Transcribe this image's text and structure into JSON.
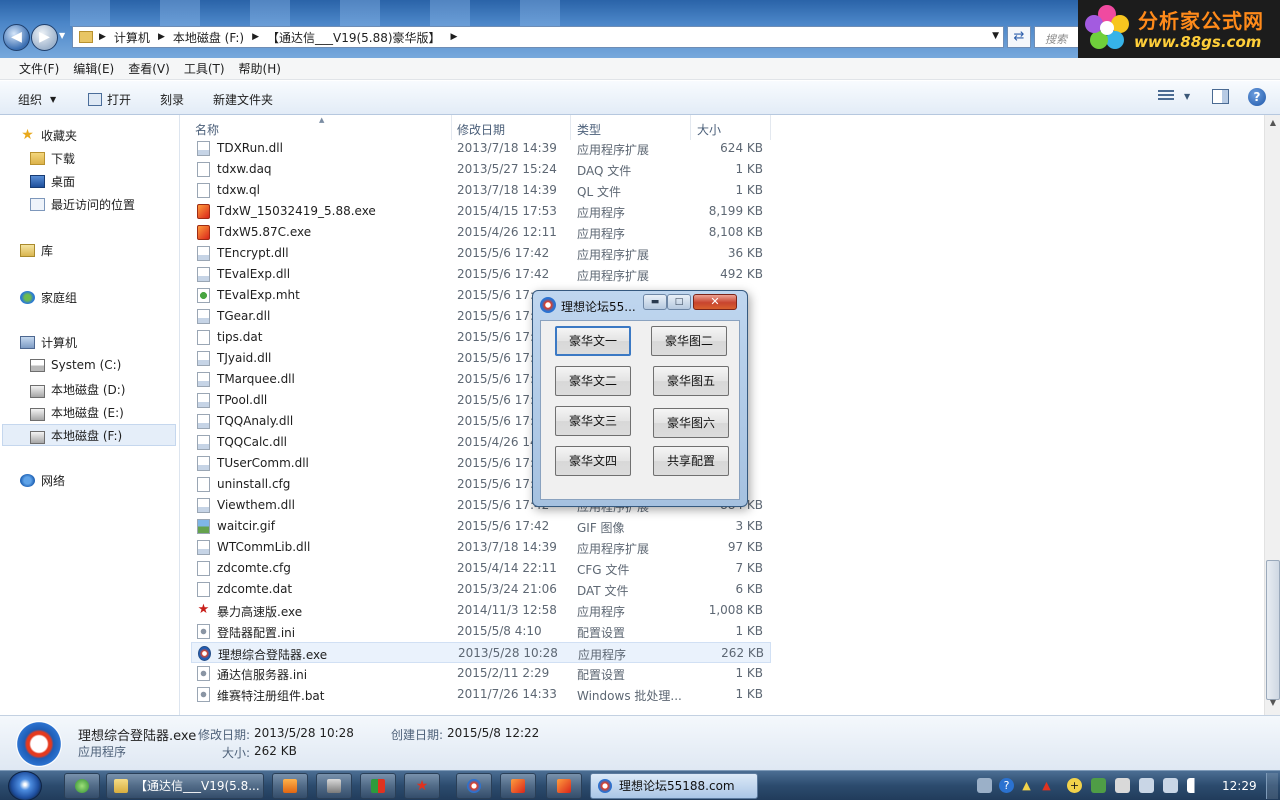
{
  "address": {
    "crumbs": [
      "计算机",
      "本地磁盘 (F:)",
      "【通达信___V19(5.88)豪华版】"
    ],
    "search_placeholder": "搜索"
  },
  "brand": {
    "name": "分析家公式网",
    "url": "www.88gs.com"
  },
  "menubar": [
    "文件(F)",
    "编辑(E)",
    "查看(V)",
    "工具(T)",
    "帮助(H)"
  ],
  "toolbar": {
    "organize": "组织",
    "open": "打开",
    "burn": "刻录",
    "new_folder": "新建文件夹",
    "help": "?"
  },
  "sidebar": {
    "favorites": "收藏夹",
    "downloads": "下载",
    "desktop": "桌面",
    "recent": "最近访问的位置",
    "libraries": "库",
    "homegroup": "家庭组",
    "computer": "计算机",
    "drive_c": "System (C:)",
    "drive_d": "本地磁盘 (D:)",
    "drive_e": "本地磁盘 (E:)",
    "drive_f": "本地磁盘 (F:)",
    "network": "网络"
  },
  "columns": {
    "name": "名称",
    "date": "修改日期",
    "type": "类型",
    "size": "大小"
  },
  "files": [
    {
      "name": "TDXRun.dll",
      "date": "2013/7/18 14:39",
      "type": "应用程序扩展",
      "size": "624 KB",
      "icon": "dll"
    },
    {
      "name": "tdxw.daq",
      "date": "2013/5/27 15:24",
      "type": "DAQ 文件",
      "size": "1 KB",
      "icon": "file"
    },
    {
      "name": "tdxw.ql",
      "date": "2013/7/18 14:39",
      "type": "QL 文件",
      "size": "1 KB",
      "icon": "file"
    },
    {
      "name": "TdxW_15032419_5.88.exe",
      "date": "2015/4/15 17:53",
      "type": "应用程序",
      "size": "8,199 KB",
      "icon": "exe"
    },
    {
      "name": "TdxW5.87C.exe",
      "date": "2015/4/26 12:11",
      "type": "应用程序",
      "size": "8,108 KB",
      "icon": "exe"
    },
    {
      "name": "TEncrypt.dll",
      "date": "2015/5/6 17:42",
      "type": "应用程序扩展",
      "size": "36 KB",
      "icon": "dll"
    },
    {
      "name": "TEvalExp.dll",
      "date": "2015/5/6 17:42",
      "type": "应用程序扩展",
      "size": "492 KB",
      "icon": "dll"
    },
    {
      "name": "TEvalExp.mht",
      "date": "2015/5/6 17:4",
      "type": "",
      "size": "",
      "icon": "mht"
    },
    {
      "name": "TGear.dll",
      "date": "2015/5/6 17:4",
      "type": "",
      "size": "",
      "icon": "dll"
    },
    {
      "name": "tips.dat",
      "date": "2015/5/6 17:4",
      "type": "",
      "size": "",
      "icon": "file"
    },
    {
      "name": "TJyaid.dll",
      "date": "2015/5/6 17:4",
      "type": "",
      "size": "",
      "icon": "dll"
    },
    {
      "name": "TMarquee.dll",
      "date": "2015/5/6 17:4",
      "type": "",
      "size": "",
      "icon": "dll"
    },
    {
      "name": "TPool.dll",
      "date": "2015/5/6 17:4",
      "type": "",
      "size": "",
      "icon": "dll"
    },
    {
      "name": "TQQAnaly.dll",
      "date": "2015/5/6 17:4",
      "type": "",
      "size": "",
      "icon": "dll"
    },
    {
      "name": "TQQCalc.dll",
      "date": "2015/4/26 14",
      "type": "",
      "size": "",
      "icon": "dll"
    },
    {
      "name": "TUserComm.dll",
      "date": "2015/5/6 17:4",
      "type": "",
      "size": "",
      "icon": "dll"
    },
    {
      "name": "uninstall.cfg",
      "date": "2015/5/6 17:4",
      "type": "",
      "size": "",
      "icon": "file"
    },
    {
      "name": "Viewthem.dll",
      "date": "2015/5/6 17:42",
      "type": "应用程序扩展",
      "size": "884 KB",
      "icon": "dll"
    },
    {
      "name": "waitcir.gif",
      "date": "2015/5/6 17:42",
      "type": "GIF 图像",
      "size": "3 KB",
      "icon": "gif"
    },
    {
      "name": "WTCommLib.dll",
      "date": "2013/7/18 14:39",
      "type": "应用程序扩展",
      "size": "97 KB",
      "icon": "dll"
    },
    {
      "name": "zdcomte.cfg",
      "date": "2015/4/14 22:11",
      "type": "CFG 文件",
      "size": "7 KB",
      "icon": "file"
    },
    {
      "name": "zdcomte.dat",
      "date": "2015/3/24 21:06",
      "type": "DAT 文件",
      "size": "6 KB",
      "icon": "file"
    },
    {
      "name": "暴力高速版.exe",
      "date": "2014/11/3 12:58",
      "type": "应用程序",
      "size": "1,008 KB",
      "icon": "red"
    },
    {
      "name": "登陆器配置.ini",
      "date": "2015/5/8 4:10",
      "type": "配置设置",
      "size": "1 KB",
      "icon": "ini"
    },
    {
      "name": "理想综合登陆器.exe",
      "date": "2013/5/28 10:28",
      "type": "应用程序",
      "size": "262 KB",
      "icon": "app",
      "selected": true
    },
    {
      "name": "通达信服务器.ini",
      "date": "2015/2/11 2:29",
      "type": "配置设置",
      "size": "1 KB",
      "icon": "ini"
    },
    {
      "name": "维赛特注册组件.bat",
      "date": "2011/7/26 14:33",
      "type": "Windows 批处理...",
      "size": "1 KB",
      "icon": "ini"
    }
  ],
  "details": {
    "filename": "理想综合登陆器.exe",
    "filetype": "应用程序",
    "modified_label": "修改日期:",
    "modified": "2013/5/28 10:28",
    "created_label": "创建日期:",
    "created": "2015/5/8 12:22",
    "size_label": "大小:",
    "size": "262 KB"
  },
  "dialog": {
    "title": "理想论坛55...",
    "buttons": [
      "豪华文一",
      "豪华图二",
      "豪华文二",
      "豪华图五",
      "豪华文三",
      "豪华图六",
      "豪华文四",
      "共享配置"
    ]
  },
  "taskbar": {
    "explorer_label": "【通达信___V19(5.8...",
    "active_label": "理想论坛55188.com",
    "clock": "12:29"
  }
}
